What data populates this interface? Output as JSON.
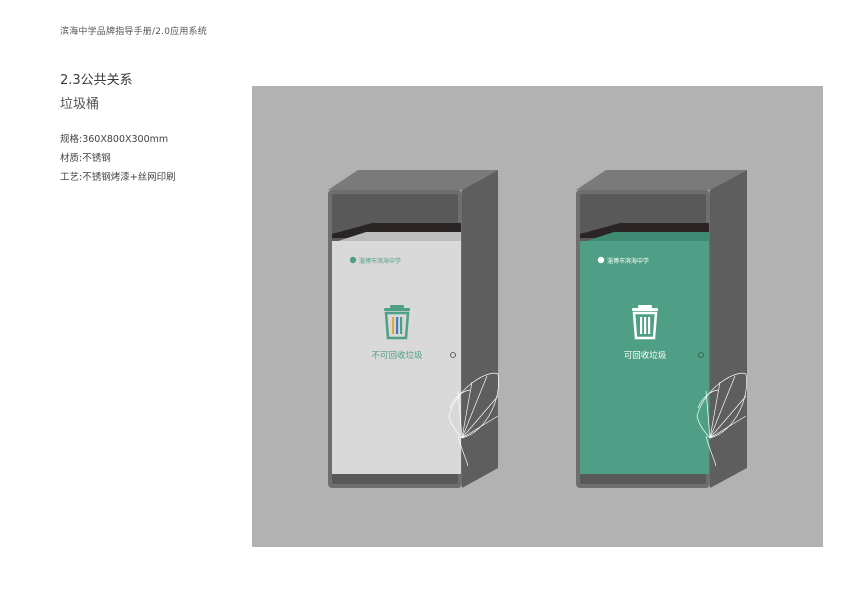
{
  "header": {
    "breadcrumb": "滨海中学品牌指导手册/2.0应用系统"
  },
  "section": {
    "title": "2.3公共关系",
    "subtitle": "垃圾桶"
  },
  "specs": [
    {
      "label": "规格",
      "value": "360X800X300mm"
    },
    {
      "label": "材质",
      "value": "不锈钢"
    },
    {
      "label": "工艺",
      "value": "不锈钢烤漆+丝网印刷"
    }
  ],
  "bins": [
    {
      "school": "淄博市滨海中学",
      "label": "不可回收垃圾",
      "color": "#d9d9d9",
      "text_color": "#4e9f86",
      "icon": "trash-icon-colored"
    },
    {
      "school": "淄博市滨海中学",
      "label": "可回收垃圾",
      "color": "#4e9f86",
      "text_color": "#ffffff",
      "icon": "trash-icon-white"
    }
  ],
  "colors": {
    "panel_bg": "#b2b2b2",
    "frame": "#6e6e6e",
    "frame_dark": "#5c5c5c",
    "brand_green": "#4e9f86"
  }
}
